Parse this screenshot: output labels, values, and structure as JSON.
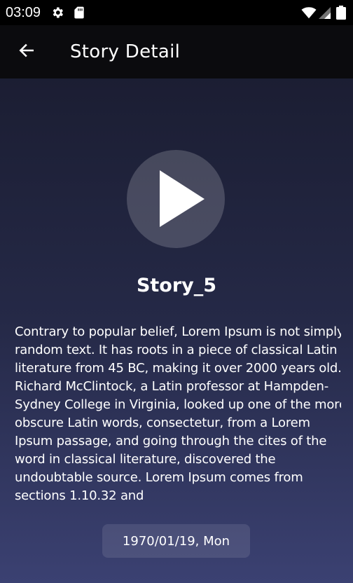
{
  "status_bar": {
    "time": "03:09",
    "icons": [
      "gear-icon",
      "sd-card-icon",
      "wifi-icon",
      "signal-icon",
      "battery-icon"
    ]
  },
  "app_bar": {
    "title": "Story Detail",
    "back_icon": "arrow-left-icon"
  },
  "player": {
    "icon": "play-icon"
  },
  "story": {
    "title": "Story_5",
    "body": "Contrary to popular belief, Lorem Ipsum is not simply random text. It has roots in a piece of classical Latin literature from 45 BC, making it over 2000 years old. Richard McClintock, a Latin professor at Hampden-Sydney College in Virginia, looked up one of the more obscure Latin words, consectetur, from a Lorem Ipsum passage, and going through the cites of the word in classical literature, discovered the undoubtable source. Lorem Ipsum comes from sections 1.10.32 and",
    "date": "1970/01/19, Mon"
  },
  "colors": {
    "background_top": "#181a2c",
    "background_bottom": "#3b4172",
    "app_bar": "#0b0b0e",
    "text": "#ffffff"
  }
}
